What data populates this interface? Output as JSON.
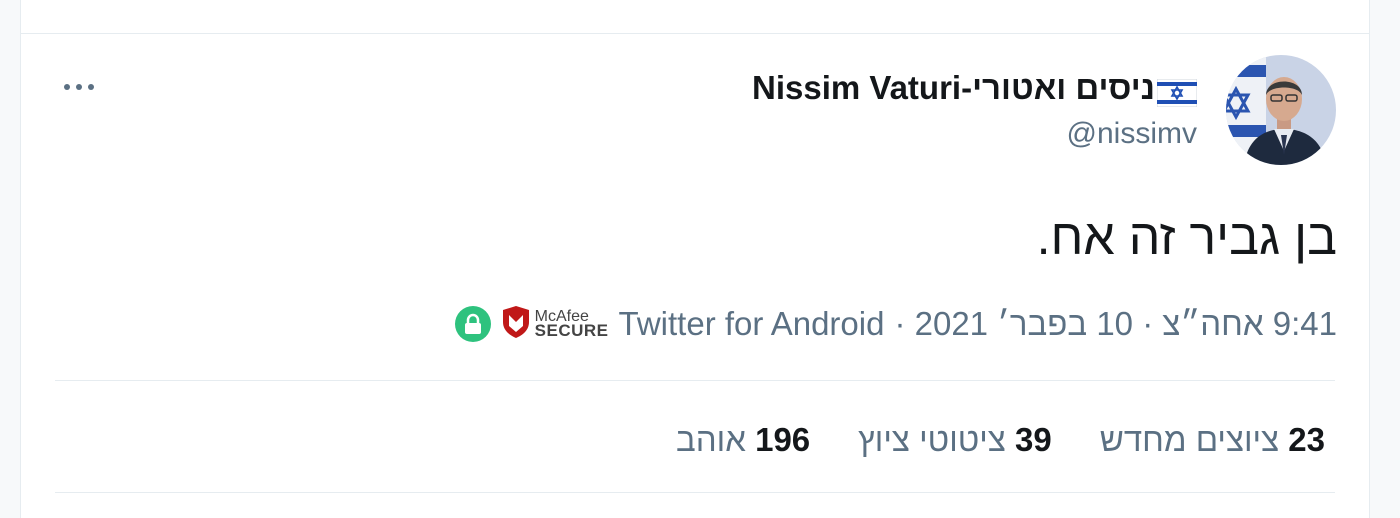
{
  "tweet": {
    "author": {
      "display_name": "ניסים ואטורי-Nissim Vaturi",
      "handle": "@nissimv",
      "flag_icon": "israel-flag-icon"
    },
    "text": "בן גביר זה אח.",
    "timestamp": "9:41 אחה״צ · 10 בפבר׳ 2021 ·",
    "source": "Twitter for Android",
    "badges": {
      "mcafee_line1": "McAfee",
      "mcafee_line2": "SECURE"
    },
    "stats": {
      "retweets_count": "23",
      "retweets_label": "ציוצים מחדש",
      "quotes_count": "39",
      "quotes_label": "ציטוטי ציוץ",
      "likes_count": "196",
      "likes_label": "אוהב"
    }
  },
  "colors": {
    "text_primary": "#14171a",
    "text_secondary": "#5b7083",
    "divider": "#e6ecf0",
    "lock_green": "#2ec27e",
    "mcafee_red": "#c01818"
  }
}
